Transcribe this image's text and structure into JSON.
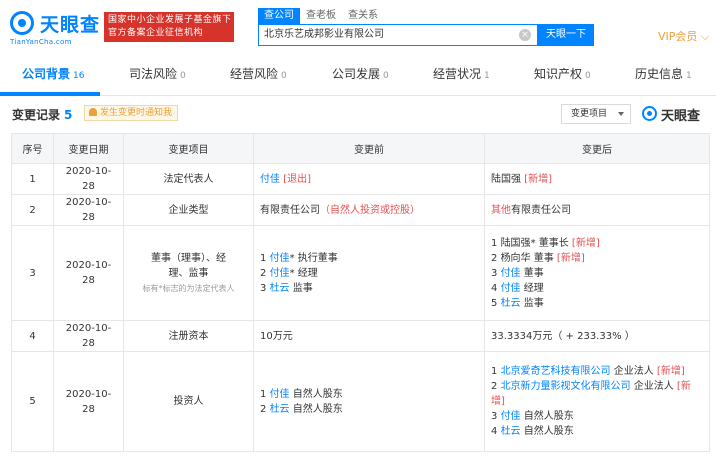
{
  "header": {
    "logo_text": "天眼查",
    "logo_sub": "TianYanCha.com",
    "badge_line1": "国家中小企业发展子基金旗下",
    "badge_line2": "官方备案企业征信机构",
    "search_tabs": [
      "查公司",
      "查老板",
      "查关系"
    ],
    "search_value": "北京乐艺成邦影业有限公司",
    "search_button": "天眼一下",
    "vip_label": "VIP会员"
  },
  "nav": {
    "tabs": [
      {
        "label": "公司背景",
        "count": "16"
      },
      {
        "label": "司法风险",
        "count": "0"
      },
      {
        "label": "经营风险",
        "count": "0"
      },
      {
        "label": "公司发展",
        "count": "0"
      },
      {
        "label": "经营状况",
        "count": "1"
      },
      {
        "label": "知识产权",
        "count": "0"
      },
      {
        "label": "历史信息",
        "count": "1"
      }
    ]
  },
  "section": {
    "title": "变更记录",
    "count": "5",
    "notify_label": "发生变更时通知我",
    "filter_label": "变更项目",
    "watermark": "天眼查"
  },
  "table": {
    "headers": [
      "序号",
      "变更日期",
      "变更项目",
      "变更前",
      "变更后"
    ],
    "rows": [
      {
        "seq": "1",
        "date": "2020-10-28",
        "item": "法定代表人",
        "before": "付佳",
        "before_tag": "[退出]",
        "after": "陆国强",
        "after_tag": "[新增]"
      },
      {
        "seq": "2",
        "date": "2020-10-28",
        "item": "企业类型",
        "before": "有限责任公司",
        "before_note": "（自然人投资或控股）",
        "after_note": "其他",
        "after": "有限责任公司"
      },
      {
        "seq": "3",
        "date": "2020-10-28",
        "item_line1": "董事（理事）、经",
        "item_line2": "理、监事",
        "item_note": "标有*标志的为法定代表人",
        "before_lines": [
          {
            "n": "1",
            "name": "付佳",
            "rest": "* 执行董事"
          },
          {
            "n": "2",
            "name": "付佳",
            "rest": "* 经理"
          },
          {
            "n": "3",
            "name": "杜云",
            "rest": " 监事"
          }
        ],
        "after_lines": [
          {
            "n": "1",
            "name": "陆国强",
            "rest": "* 董事长 ",
            "tag": "[新增]"
          },
          {
            "n": "2",
            "name": "杨向华",
            "rest": " 董事 ",
            "tag": "[新增]"
          },
          {
            "n": "3",
            "name": "付佳",
            "rest": " 董事",
            "tag": ""
          },
          {
            "n": "4",
            "name": "付佳",
            "rest": " 经理",
            "tag": ""
          },
          {
            "n": "5",
            "name": "杜云",
            "rest": " 监事",
            "tag": ""
          }
        ]
      },
      {
        "seq": "4",
        "date": "2020-10-28",
        "item": "注册资本",
        "before": "10万元",
        "after": "33.3334万元（ + 233.33% ）"
      },
      {
        "seq": "5",
        "date": "2020-10-28",
        "item": "投资人",
        "before_lines": [
          {
            "n": "1",
            "name": "付佳",
            "rest": " 自然人股东"
          },
          {
            "n": "2",
            "name": "杜云",
            "rest": " 自然人股东"
          }
        ],
        "after_lines": [
          {
            "n": "1",
            "name": "北京爱奇艺科技有限公司",
            "rest": " 企业法人 ",
            "tag": "[新增]"
          },
          {
            "n": "2",
            "name": "北京新力量影视文化有限公司",
            "rest": " 企业法人 ",
            "tag": "[新增]"
          },
          {
            "n": "3",
            "name": "付佳",
            "rest": " 自然人股东",
            "tag": ""
          },
          {
            "n": "4",
            "name": "杜云",
            "rest": " 自然人股东",
            "tag": ""
          }
        ]
      }
    ]
  }
}
